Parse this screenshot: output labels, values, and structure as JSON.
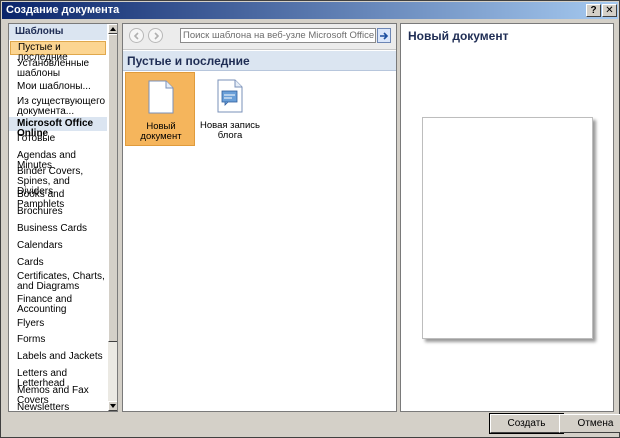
{
  "window": {
    "title": "Создание документа",
    "help_glyph": "?",
    "close_glyph": "✕"
  },
  "sidebar": {
    "header": "Шаблоны",
    "items": [
      {
        "label": "Пустые и последние",
        "selected": true
      },
      {
        "label": "Установленные шаблоны"
      },
      {
        "label": "Мои шаблоны..."
      },
      {
        "label": "Из существующего документа..."
      },
      {
        "label": "Microsoft Office Online",
        "group": true
      },
      {
        "label": "Готовые"
      },
      {
        "label": "Agendas and Minutes"
      },
      {
        "label": "Binder Covers, Spines, and Dividers"
      },
      {
        "label": "Books and Pamphlets"
      },
      {
        "label": "Brochures"
      },
      {
        "label": "Business Cards"
      },
      {
        "label": "Calendars"
      },
      {
        "label": "Cards"
      },
      {
        "label": "Certificates, Charts, and Diagrams"
      },
      {
        "label": "Finance and Accounting"
      },
      {
        "label": "Flyers"
      },
      {
        "label": "Forms"
      },
      {
        "label": "Labels and Jackets"
      },
      {
        "label": "Letters and Letterhead"
      },
      {
        "label": "Memos and Fax Covers"
      },
      {
        "label": "Newsletters"
      }
    ]
  },
  "toolbar": {
    "search_placeholder": "Поиск шаблона на веб-узле Microsoft Office Online"
  },
  "main": {
    "section_title": "Пустые и последние",
    "templates": [
      {
        "label": "Новый документ",
        "selected": true,
        "icon": "blank-document-icon"
      },
      {
        "label": "Новая запись блога",
        "icon": "blog-post-icon"
      }
    ]
  },
  "preview": {
    "title": "Новый документ"
  },
  "buttons": {
    "create": "Создать",
    "cancel": "Отмена"
  },
  "colors": {
    "titlebar_start": "#0a246a",
    "titlebar_end": "#a6caf0",
    "selection": "#f5b55c",
    "header_bg": "#dbe5f1"
  }
}
